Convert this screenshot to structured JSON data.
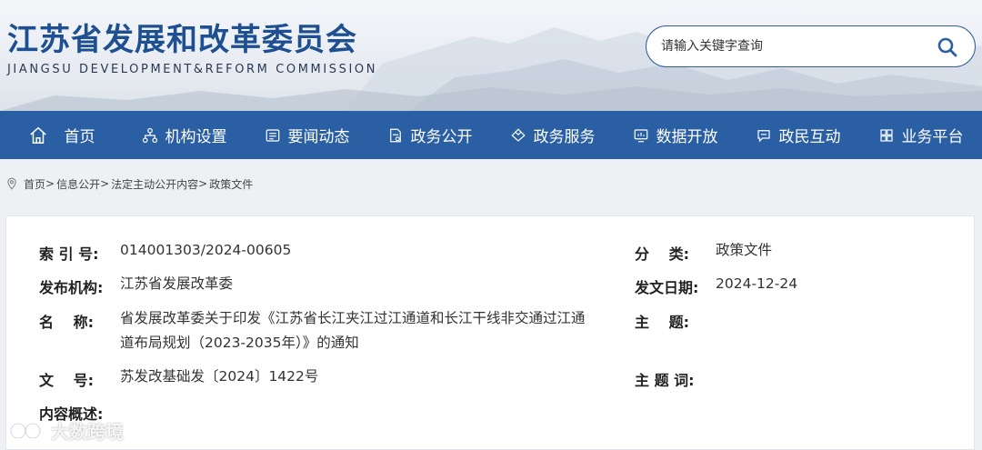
{
  "header": {
    "title": "江苏省发展和改革委员会",
    "subtitle": "JIANGSU DEVELOPMENT&REFORM COMMISSION",
    "search_placeholder": "请输入关键字查询"
  },
  "nav": {
    "items": [
      {
        "label": "首页",
        "icon": "home-icon"
      },
      {
        "label": "机构设置",
        "icon": "org-chart-icon"
      },
      {
        "label": "要闻动态",
        "icon": "news-icon"
      },
      {
        "label": "政务公开",
        "icon": "document-icon"
      },
      {
        "label": "政务服务",
        "icon": "service-icon"
      },
      {
        "label": "数据开放",
        "icon": "monitor-icon"
      },
      {
        "label": "政民互动",
        "icon": "chat-icon"
      },
      {
        "label": "业务平台",
        "icon": "grid-icon"
      }
    ]
  },
  "breadcrumb": {
    "items": [
      "首页",
      "信息公开",
      "法定主动公开内容",
      "政策文件"
    ],
    "separator": ">"
  },
  "doc_info": {
    "index_label": "索 引 号:",
    "index_value": "014001303/2024-00605",
    "category_label": "分　 类:",
    "category_value": "政策文件",
    "publisher_label": "发布机构:",
    "publisher_value": "江苏省发展改革委",
    "date_label": "发文日期:",
    "date_value": "2024-12-24",
    "name_label": "名　 称:",
    "name_value_line1": "省发展改革委关于印发《江苏省长江夹江过江通道和长江干线非交通过江通",
    "name_value_line2": "道布局规划（2023-2035年）》的通知",
    "topic_label": "主　 题:",
    "topic_value": "",
    "docno_label": "文　 号:",
    "docno_value": "苏发改基础发〔2024〕1422号",
    "keywords_label": "主 题 词:",
    "keywords_value": "",
    "summary_label": "内容概述:",
    "summary_value": ""
  },
  "watermark": {
    "text": "大数跨境"
  }
}
